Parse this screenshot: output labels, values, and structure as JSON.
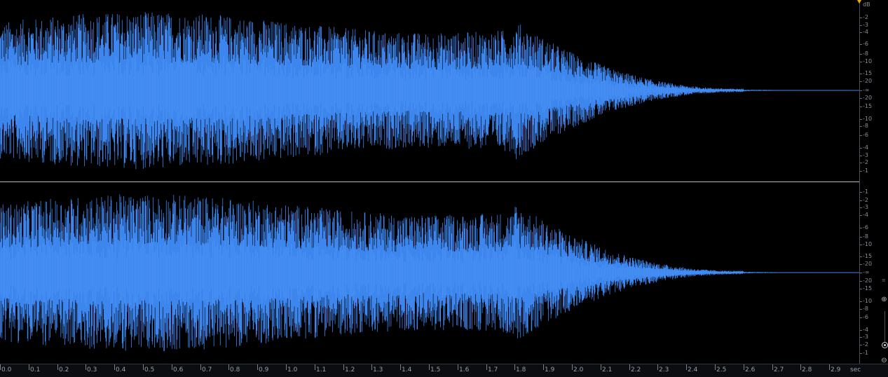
{
  "colors": {
    "background": "#000000",
    "waveform": "#3d86ee",
    "waveform_peak": "#5aa0ff",
    "divider": "#b9bcc2",
    "text": "#8a8f99",
    "playhead": "#e6b400"
  },
  "db_ruler": {
    "unit_label": "dB",
    "top_channel": [
      "-2",
      "-3",
      "-4",
      "-6",
      "-8",
      "-10",
      "-15",
      "-20",
      "-∞",
      "-20",
      "-15",
      "-10",
      "-8",
      "-6",
      "-4",
      "-3",
      "-2",
      "-1"
    ],
    "bottom_channel": [
      "-1",
      "-2",
      "-3",
      "-4",
      "-6",
      "-8",
      "-10",
      "-15",
      "-20",
      "-∞",
      "-20",
      "-15",
      "-10",
      "-8",
      "-6",
      "-4",
      "-3",
      "-2",
      "-1"
    ]
  },
  "timeline": {
    "unit_label": "sec",
    "ticks": [
      "0.0",
      "0.1",
      "0.2",
      "0.3",
      "0.4",
      "0.5",
      "0.6",
      "0.7",
      "0.8",
      "0.9",
      "1.0",
      "1.1",
      "1.2",
      "1.3",
      "1.4",
      "1.5",
      "1.6",
      "1.7",
      "1.8",
      "1.9",
      "2.0",
      "2.1",
      "2.2",
      "2.3",
      "2.4",
      "2.5",
      "2.6",
      "2.7",
      "2.8",
      "2.9"
    ]
  },
  "waveform": {
    "channels": 2,
    "duration_sec": 3.0,
    "decay_start_sec": 1.8,
    "silence_after_sec": 2.6
  },
  "zoom": {
    "zoom_in_icon": "zoom-in-icon",
    "zoom_out_icon": "zoom-out-icon",
    "zoom_level": 0.1
  }
}
